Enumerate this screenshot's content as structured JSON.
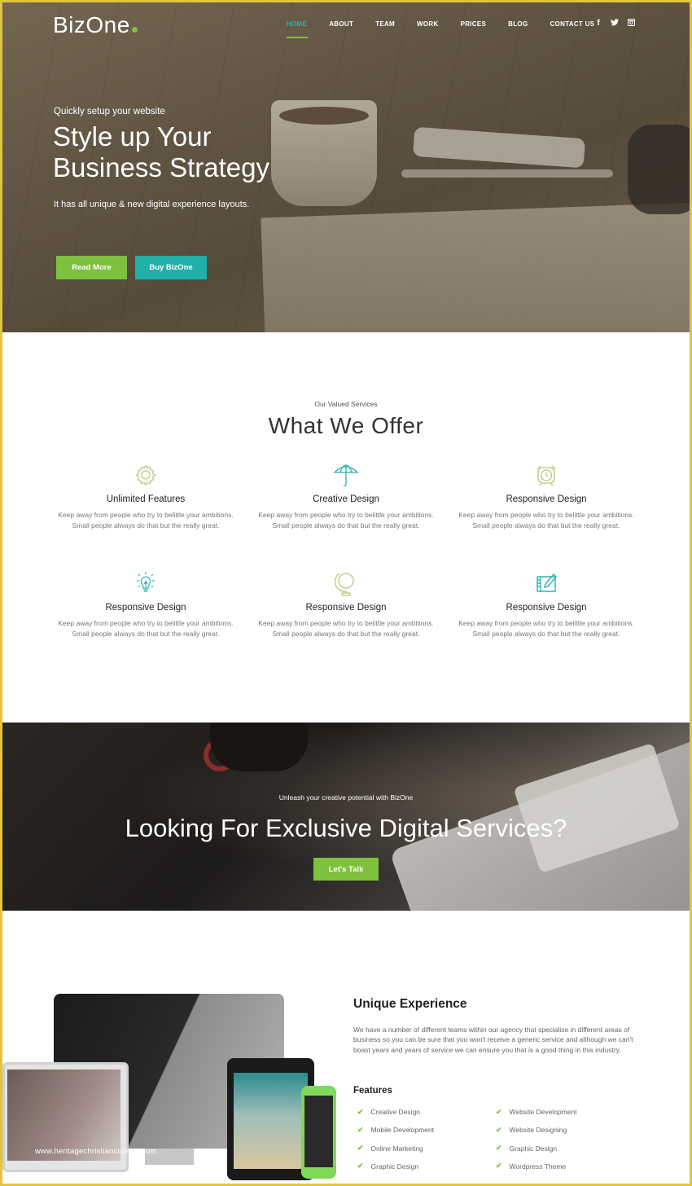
{
  "brand": {
    "name": "BizOne",
    "accent_green": "#7dc13c",
    "accent_teal": "#1fb0aa"
  },
  "nav": {
    "items": [
      {
        "label": "HOME",
        "active": true
      },
      {
        "label": "ABOUT",
        "active": false
      },
      {
        "label": "TEAM",
        "active": false
      },
      {
        "label": "WORK",
        "active": false
      },
      {
        "label": "PRICES",
        "active": false
      },
      {
        "label": "BLOG",
        "active": false
      },
      {
        "label": "CONTACT US",
        "active": false
      }
    ],
    "social": [
      {
        "icon": "facebook-icon",
        "glyph": "f"
      },
      {
        "icon": "twitter-icon",
        "glyph": "t"
      },
      {
        "icon": "instagram-icon",
        "glyph": "◙"
      }
    ]
  },
  "hero": {
    "subtitle": "Quickly setup your website",
    "title": "Style up Your Business Strategy",
    "description": "It has all unique & new digital experience layouts.",
    "primary_button": "Read More",
    "secondary_button": "Buy BizOne"
  },
  "services": {
    "subtitle": "Our Valued Services",
    "title": "What We Offer",
    "items": [
      {
        "icon": "gear-icon",
        "title": "Unlimited Features",
        "text": "Keep away from people who try to belittle your ambitions. Small people always do that but the really great."
      },
      {
        "icon": "umbrella-icon",
        "title": "Creative Design",
        "text": "Keep away from people who try to belittle your ambitions. Small people always do that but the really great."
      },
      {
        "icon": "alarm-clock-icon",
        "title": "Responsive Design",
        "text": "Keep away from people who try to belittle your ambitions. Small people always do that but the really great."
      },
      {
        "icon": "lightbulb-icon",
        "title": "Responsive Design",
        "text": "Keep away from people who try to belittle your ambitions. Small people always do that but the really great."
      },
      {
        "icon": "globe-icon",
        "title": "Responsive Design",
        "text": "Keep away from people who try to belittle your ambitions. Small people always do that but the really great."
      },
      {
        "icon": "drawing-tablet-icon",
        "title": "Responsive Design",
        "text": "Keep away from people who try to belittle your ambitions. Small people always do that but the really great."
      }
    ]
  },
  "cta": {
    "subtitle": "Unleash your creative potential with BizOne",
    "title": "Looking For Exclusive Digital Services?",
    "button": "Let's Talk"
  },
  "unique": {
    "title": "Unique Experience",
    "text": "We have a number of different teams within our agency that specialise in different areas of business so you can be sure that you won't receive a generic service and although we can't boast years and years of service we can ensure you that is a good thing in this industry.",
    "features_title": "Features",
    "features": [
      "Creative Design",
      "Website Development",
      "Mobile Development",
      "Website Designing",
      "Online Marketing",
      "Graphic Design",
      "Graphic Design",
      "Wordpress Theme"
    ],
    "watermark": "www.heritagechristiancollege.com"
  }
}
